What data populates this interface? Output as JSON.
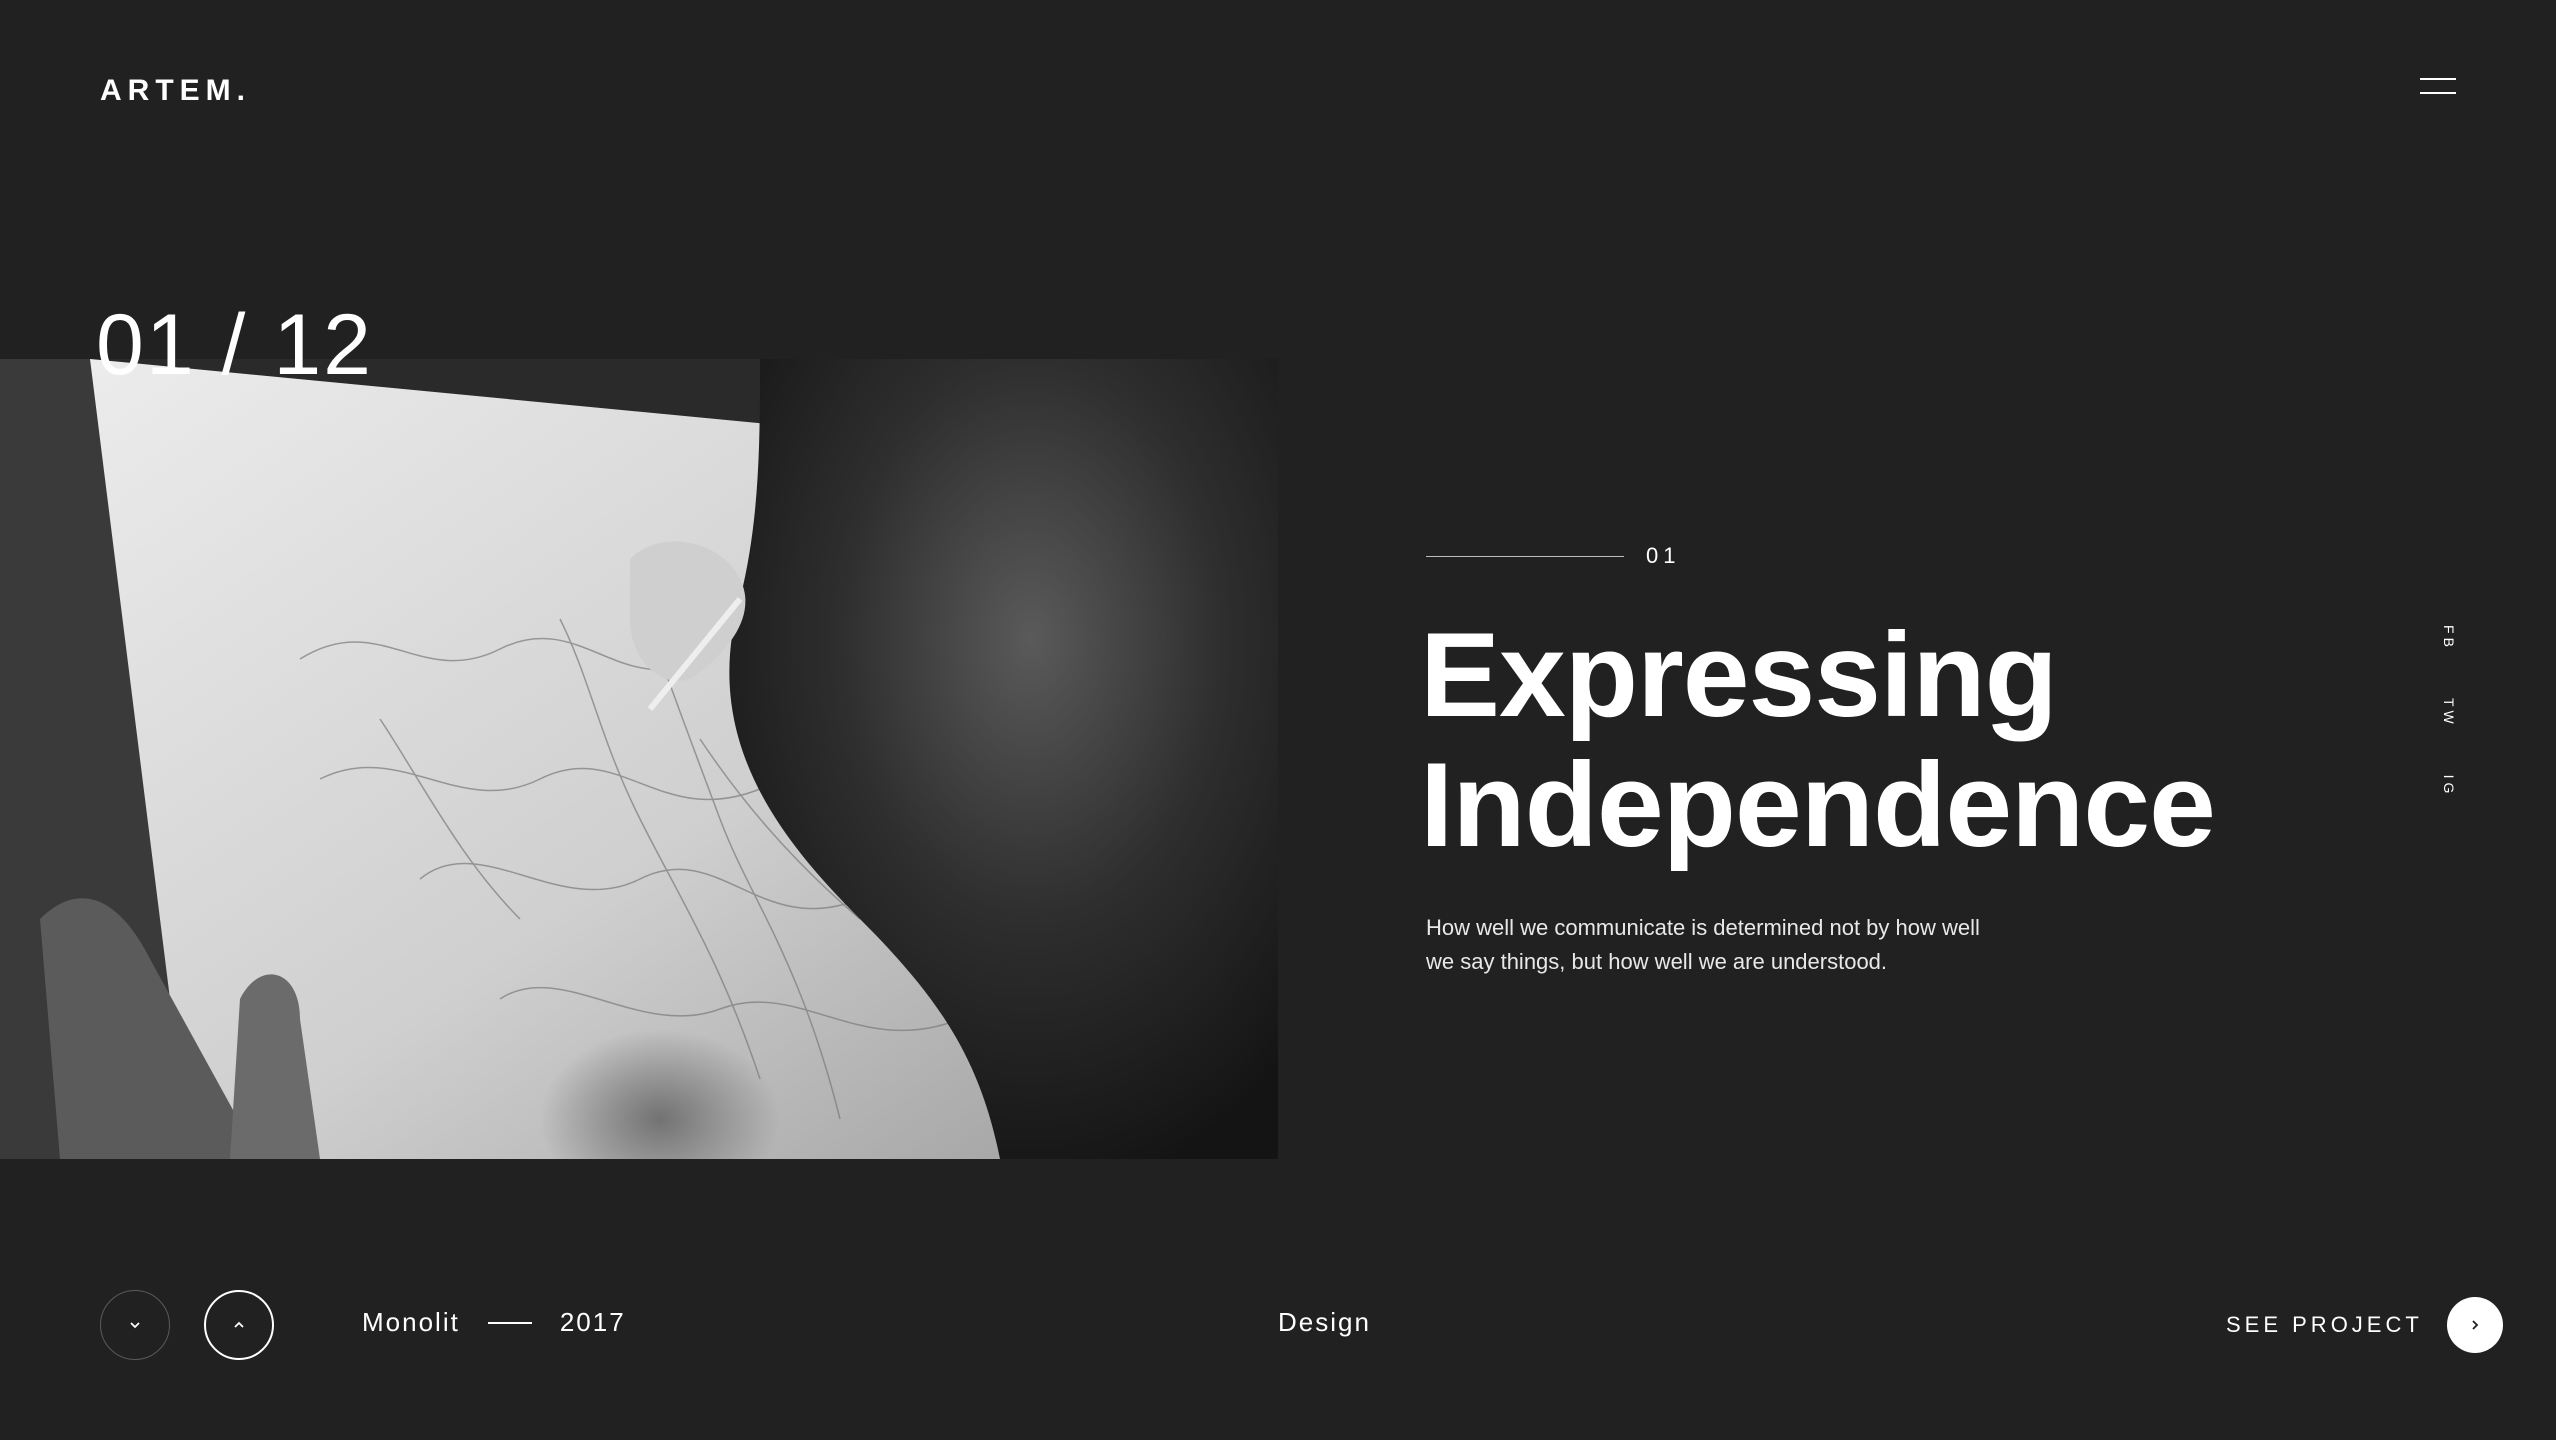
{
  "header": {
    "logo": "ARTEM.",
    "menu_icon": "hamburger-menu-icon"
  },
  "slide": {
    "counter": "01 / 12",
    "index_label": "01",
    "title_line1": "Expressing",
    "title_line2": "Independence",
    "description": "How well we communicate is determined not by how well we say things, but how well we are understood."
  },
  "social": {
    "items": [
      {
        "label": "FB"
      },
      {
        "label": "TW"
      },
      {
        "label": "IG"
      }
    ]
  },
  "footer": {
    "project_name": "Monolit",
    "year": "2017",
    "category": "Design",
    "see_project_label": "SEE PROJECT",
    "prev_icon": "chevron-down-icon",
    "next_icon": "chevron-up-icon",
    "arrow_icon": "chevron-right-icon"
  },
  "colors": {
    "background": "#212121",
    "text": "#ffffff",
    "muted_rule": "#bdbdbd"
  }
}
